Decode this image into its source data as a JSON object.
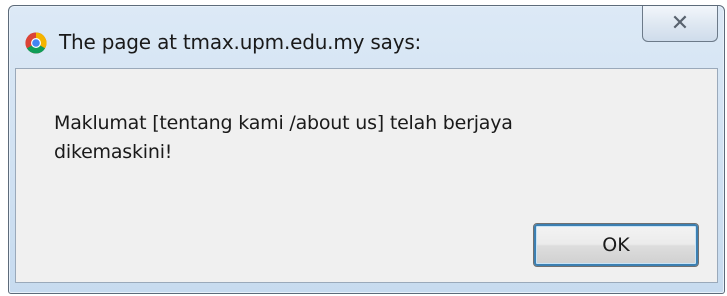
{
  "dialog": {
    "title": "The page at tmax.upm.edu.my says:",
    "message": "Maklumat [tentang kami /about us] telah berjaya dikemaskini!",
    "ok_label": "OK",
    "close_glyph": "✕",
    "icon": "chrome-icon"
  }
}
